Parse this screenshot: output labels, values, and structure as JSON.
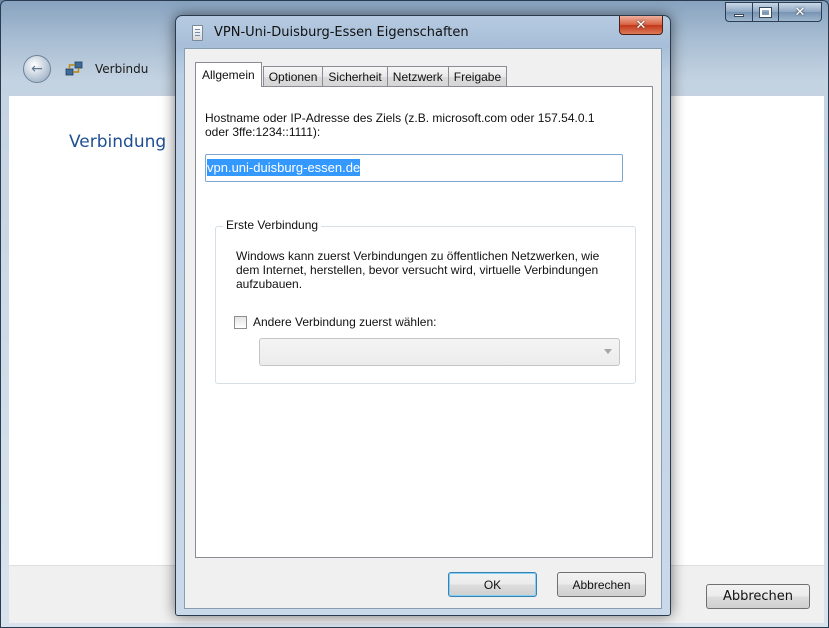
{
  "background_window": {
    "nav_title": "Verbindu",
    "heading": "Verbindung",
    "cancel_label": "Abbrechen"
  },
  "dialog": {
    "title": "VPN-Uni-Duisburg-Essen Eigenschaften",
    "tabs": [
      {
        "label": "Allgemein",
        "active": true
      },
      {
        "label": "Optionen",
        "active": false
      },
      {
        "label": "Sicherheit",
        "active": false
      },
      {
        "label": "Netzwerk",
        "active": false
      },
      {
        "label": "Freigabe",
        "active": false
      }
    ],
    "hostname_label": "Hostname oder IP-Adresse des Ziels (z.B. microsoft.com oder 157.54.0.1 oder 3ffe:1234::1111):",
    "hostname_value": "vpn.uni-duisburg-essen.de",
    "group": {
      "legend": "Erste Verbindung",
      "text": "Windows kann zuerst Verbindungen zu öffentlichen Netzwerken, wie dem Internet, herstellen, bevor versucht wird, virtuelle Verbindungen aufzubauen.",
      "checkbox_label": "Andere Verbindung zuerst wählen:",
      "checkbox_checked": false,
      "select_value": ""
    },
    "ok_label": "OK",
    "cancel_label": "Abbrechen"
  },
  "colors": {
    "accent_heading": "#1e4e94",
    "selection": "#3399ff",
    "close_button": "#c3381b"
  }
}
